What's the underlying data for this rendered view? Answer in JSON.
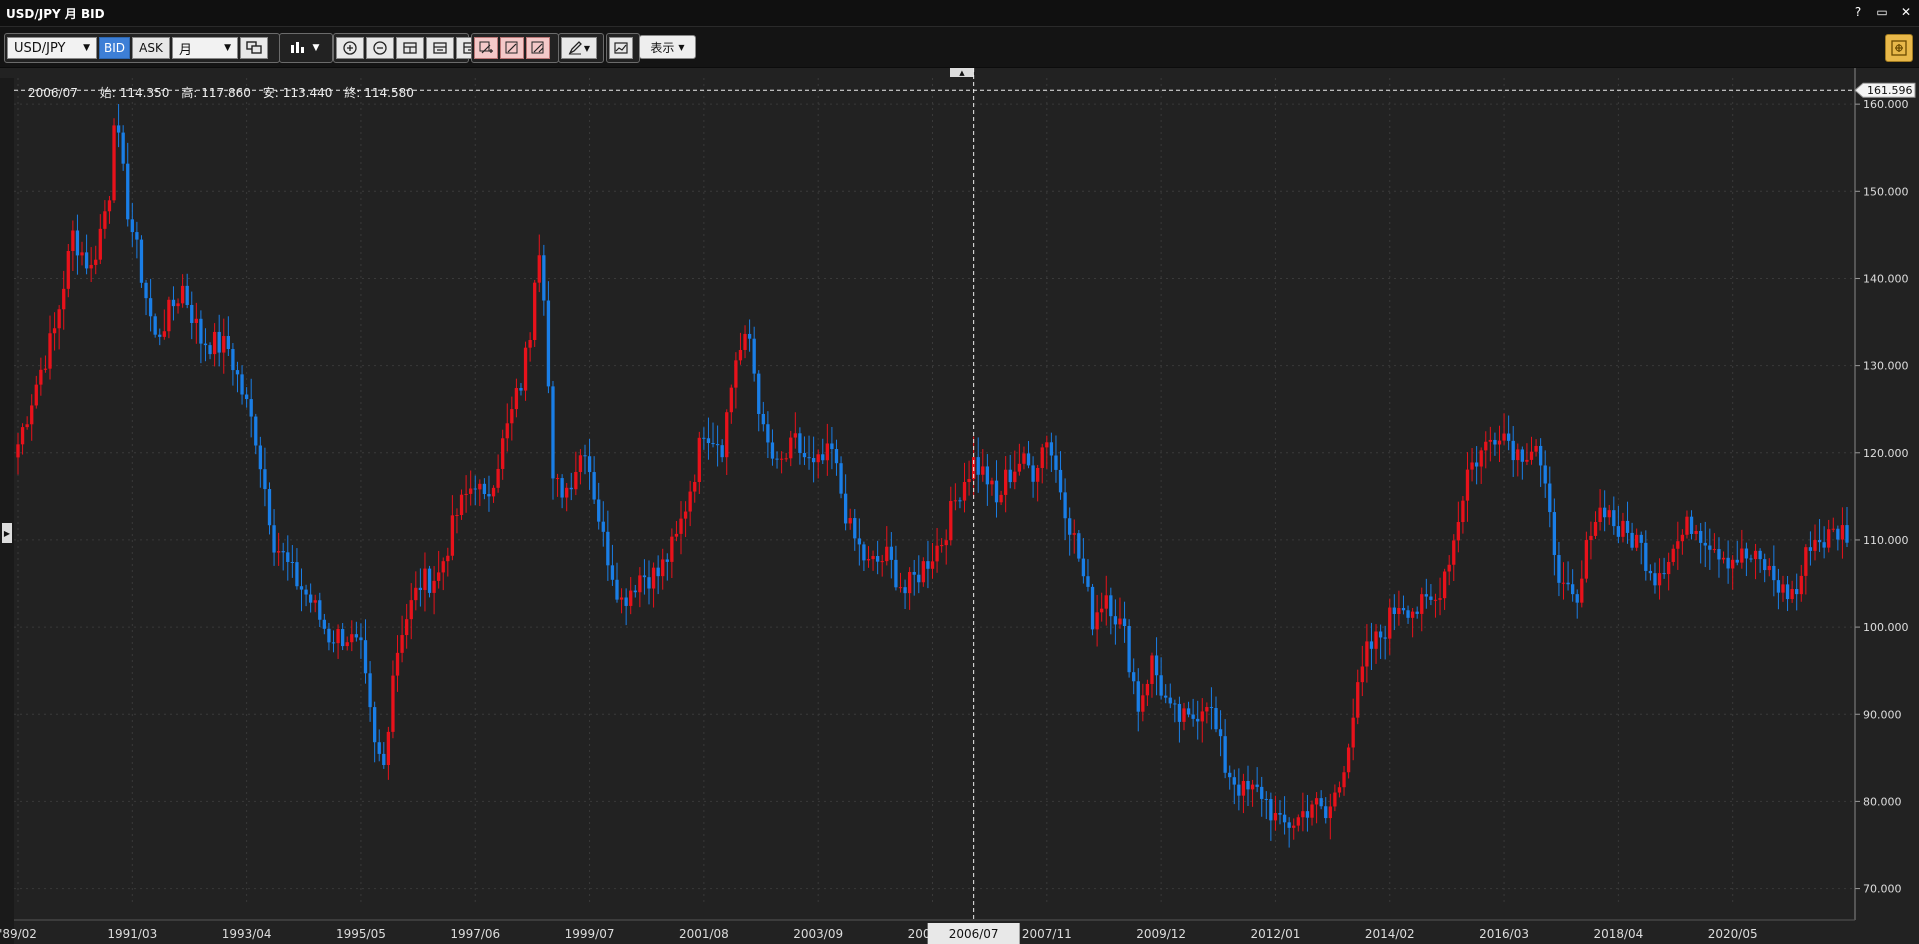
{
  "window": {
    "title": "USD/JPY 月 BID",
    "buttons": [
      "?",
      "▭",
      "✕"
    ]
  },
  "toolbar": {
    "symbol": "USD/JPY",
    "bid_label": "BID",
    "ask_label": "ASK",
    "period": "月",
    "display_label": "表示",
    "icons": [
      "compare-icon",
      "candle-type-icon",
      "zoom-in-icon",
      "zoom-out-icon",
      "fit-icon",
      "range-icon",
      "scroll-end-icon",
      "draw-add-icon",
      "draw-edit-icon",
      "draw-delete-icon",
      "pen-icon",
      "indicator-icon",
      "settings-icon"
    ]
  },
  "ohlc": {
    "date": "2006/07",
    "open_label": "始:",
    "open": "114.350",
    "high_label": "高:",
    "high": "117.860",
    "low_label": "安:",
    "low": "113.440",
    "close_label": "終:",
    "close": "114.580"
  },
  "crosshair": {
    "price_label": "161.596",
    "date_label": "2006/07",
    "price": 161.596
  },
  "colors": {
    "up": "#e8121b",
    "down": "#1a7ee6",
    "grid": "#3a3a3a",
    "background": "#222222"
  },
  "chart_data": {
    "type": "candlestick",
    "x_range": [
      "1989/02",
      "2021/09"
    ],
    "ylim": [
      68,
      163
    ],
    "yticks": [
      70,
      80,
      90,
      100,
      110,
      120,
      130,
      140,
      150,
      160
    ],
    "ytick_labels": [
      "70.000",
      "80.000",
      "90.000",
      "100.000",
      "110.000",
      "120.000",
      "130.000",
      "140.000",
      "150.000",
      "160.000"
    ],
    "xtick_labels": [
      "'89/02",
      "1991/03",
      "1993/04",
      "1995/05",
      "1997/06",
      "1999/07",
      "2001/08",
      "2003/09",
      "2005/10",
      "2007/11",
      "2009/12",
      "2012/01",
      "2014/02",
      "2016/03",
      "2018/04",
      "2020/05"
    ],
    "xtick_index": [
      0,
      25,
      50,
      75,
      100,
      125,
      150,
      175,
      200,
      225,
      250,
      275,
      300,
      325,
      350,
      375
    ],
    "key_closes": [
      {
        "i": 0,
        "v": 121
      },
      {
        "i": 4,
        "v": 128
      },
      {
        "i": 8,
        "v": 134
      },
      {
        "i": 12,
        "v": 145
      },
      {
        "i": 16,
        "v": 141
      },
      {
        "i": 20,
        "v": 150
      },
      {
        "i": 21,
        "v": 159
      },
      {
        "i": 24,
        "v": 148
      },
      {
        "i": 30,
        "v": 133
      },
      {
        "i": 36,
        "v": 139
      },
      {
        "i": 40,
        "v": 133
      },
      {
        "i": 46,
        "v": 132
      },
      {
        "i": 52,
        "v": 122
      },
      {
        "i": 56,
        "v": 110
      },
      {
        "i": 60,
        "v": 106
      },
      {
        "i": 64,
        "v": 103
      },
      {
        "i": 68,
        "v": 99
      },
      {
        "i": 72,
        "v": 99
      },
      {
        "i": 75,
        "v": 97
      },
      {
        "i": 78,
        "v": 86
      },
      {
        "i": 80,
        "v": 84
      },
      {
        "i": 82,
        "v": 95
      },
      {
        "i": 84,
        "v": 100
      },
      {
        "i": 88,
        "v": 105
      },
      {
        "i": 92,
        "v": 106
      },
      {
        "i": 96,
        "v": 113
      },
      {
        "i": 100,
        "v": 117
      },
      {
        "i": 102,
        "v": 114
      },
      {
        "i": 106,
        "v": 121
      },
      {
        "i": 110,
        "v": 128
      },
      {
        "i": 112,
        "v": 134
      },
      {
        "i": 113,
        "v": 141
      },
      {
        "i": 114,
        "v": 144
      },
      {
        "i": 115,
        "v": 139
      },
      {
        "i": 117,
        "v": 116
      },
      {
        "i": 120,
        "v": 116
      },
      {
        "i": 124,
        "v": 121
      },
      {
        "i": 128,
        "v": 110
      },
      {
        "i": 132,
        "v": 103
      },
      {
        "i": 136,
        "v": 106
      },
      {
        "i": 140,
        "v": 106
      },
      {
        "i": 144,
        "v": 110
      },
      {
        "i": 148,
        "v": 118
      },
      {
        "i": 150,
        "v": 123
      },
      {
        "i": 154,
        "v": 121
      },
      {
        "i": 157,
        "v": 131
      },
      {
        "i": 160,
        "v": 133
      },
      {
        "i": 163,
        "v": 122
      },
      {
        "i": 166,
        "v": 118
      },
      {
        "i": 170,
        "v": 121
      },
      {
        "i": 174,
        "v": 118
      },
      {
        "i": 178,
        "v": 120
      },
      {
        "i": 182,
        "v": 111
      },
      {
        "i": 186,
        "v": 107
      },
      {
        "i": 190,
        "v": 108
      },
      {
        "i": 194,
        "v": 104
      },
      {
        "i": 198,
        "v": 107
      },
      {
        "i": 202,
        "v": 110
      },
      {
        "i": 206,
        "v": 116
      },
      {
        "i": 209,
        "v": 119
      },
      {
        "i": 212,
        "v": 117
      },
      {
        "i": 214,
        "v": 114
      },
      {
        "i": 216,
        "v": 117
      },
      {
        "i": 219,
        "v": 119
      },
      {
        "i": 222,
        "v": 118
      },
      {
        "i": 225,
        "v": 122
      },
      {
        "i": 228,
        "v": 116
      },
      {
        "i": 232,
        "v": 108
      },
      {
        "i": 235,
        "v": 101
      },
      {
        "i": 238,
        "v": 104
      },
      {
        "i": 242,
        "v": 99
      },
      {
        "i": 245,
        "v": 91
      },
      {
        "i": 248,
        "v": 96
      },
      {
        "i": 252,
        "v": 90
      },
      {
        "i": 256,
        "v": 89
      },
      {
        "i": 260,
        "v": 92
      },
      {
        "i": 264,
        "v": 84
      },
      {
        "i": 268,
        "v": 81
      },
      {
        "i": 272,
        "v": 81
      },
      {
        "i": 276,
        "v": 77
      },
      {
        "i": 280,
        "v": 78
      },
      {
        "i": 283,
        "v": 80
      },
      {
        "i": 286,
        "v": 78
      },
      {
        "i": 289,
        "v": 82
      },
      {
        "i": 292,
        "v": 90
      },
      {
        "i": 295,
        "v": 97
      },
      {
        "i": 298,
        "v": 99
      },
      {
        "i": 302,
        "v": 103
      },
      {
        "i": 306,
        "v": 102
      },
      {
        "i": 310,
        "v": 103
      },
      {
        "i": 314,
        "v": 110
      },
      {
        "i": 317,
        "v": 118
      },
      {
        "i": 320,
        "v": 120
      },
      {
        "i": 324,
        "v": 123
      },
      {
        "i": 328,
        "v": 120
      },
      {
        "i": 332,
        "v": 121
      },
      {
        "i": 335,
        "v": 112
      },
      {
        "i": 338,
        "v": 104
      },
      {
        "i": 341,
        "v": 102
      },
      {
        "i": 344,
        "v": 112
      },
      {
        "i": 347,
        "v": 114
      },
      {
        "i": 350,
        "v": 111
      },
      {
        "i": 354,
        "v": 110
      },
      {
        "i": 358,
        "v": 106
      },
      {
        "i": 362,
        "v": 109
      },
      {
        "i": 366,
        "v": 112
      },
      {
        "i": 370,
        "v": 110
      },
      {
        "i": 374,
        "v": 108
      },
      {
        "i": 378,
        "v": 108
      },
      {
        "i": 382,
        "v": 107
      },
      {
        "i": 386,
        "v": 104
      },
      {
        "i": 389,
        "v": 104
      },
      {
        "i": 392,
        "v": 110
      },
      {
        "i": 395,
        "v": 110
      },
      {
        "i": 398,
        "v": 111
      }
    ]
  }
}
